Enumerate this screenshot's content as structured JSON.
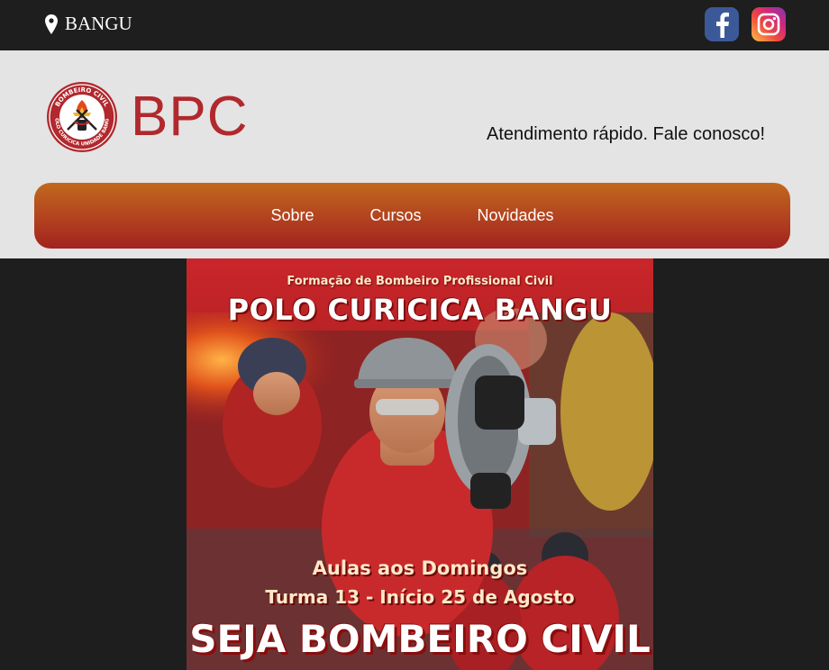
{
  "topbar": {
    "location": "BANGU",
    "icons": {
      "location": "map-pin-icon",
      "facebook": "facebook-icon",
      "instagram": "instagram-icon"
    }
  },
  "header": {
    "brand": "BPC",
    "tagline": "Atendimento rápido. Fale conosco!",
    "logo_ring_top": "BOMBEIRO CIVIL",
    "logo_ring_bottom": "POLO CURICICA UNIDADE BANGU"
  },
  "nav": {
    "items": [
      {
        "label": "Sobre"
      },
      {
        "label": "Cursos"
      },
      {
        "label": "Novidades"
      }
    ]
  },
  "banner": {
    "kicker": "Formação de Bombeiro Profissional Civil",
    "title": "POLO CURICICA BANGU",
    "line1": "Aulas aos Domingos",
    "line2": "Turma 13 - Início 25 de Agosto",
    "cta": "SEJA BOMBEIRO CIVIL"
  },
  "colors": {
    "brand": "#b1282d",
    "nav_top": "#c1691d",
    "nav_bottom": "#a2231f",
    "background": "#1e1e1e",
    "header_bg": "#e4e4e4"
  }
}
